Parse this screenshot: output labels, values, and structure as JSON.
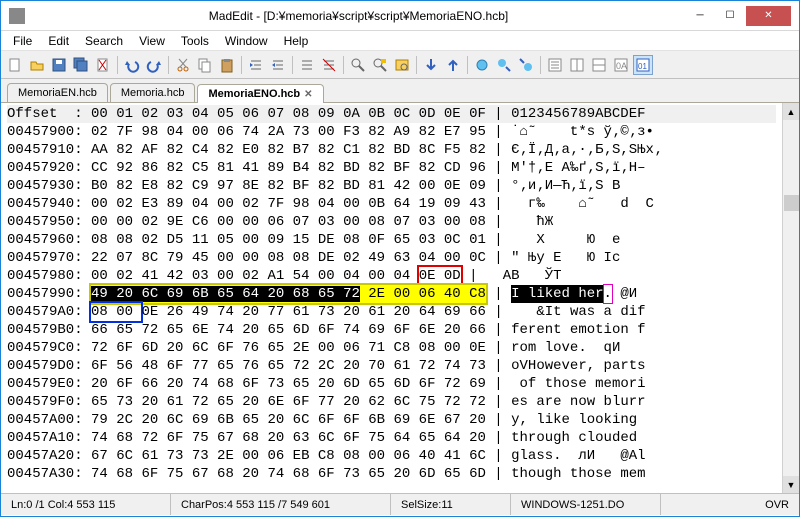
{
  "window": {
    "title": "MadEdit - [D:¥memoria¥script¥script¥MemoriaENO.hcb]"
  },
  "menu": {
    "file": "File",
    "edit": "Edit",
    "search": "Search",
    "view": "View",
    "tools": "Tools",
    "window": "Window",
    "help": "Help"
  },
  "tabs": [
    {
      "label": "MemoriaEN.hcb",
      "active": false
    },
    {
      "label": "Memoria.hcb",
      "active": false
    },
    {
      "label": "MemoriaENO.hcb",
      "active": true
    }
  ],
  "hex": {
    "header_offset": "Offset  ",
    "header_cols": ": 00 01 02 03 04 05 06 07 08 09 0A 0B 0C 0D 0E 0F | 0123456789ABCDEF",
    "rows": [
      {
        "off": "00457900",
        "b": "02 7F 98 04 00 06 74 2A 73 00 F3 82 A9 82 E7 95",
        "a": "˙⌂˜    t*s ў‚©‚з•"
      },
      {
        "off": "00457910",
        "b": "AA 82 AF 82 C4 82 E0 82 B7 82 C1 82 BD 8C F5 82",
        "a": "Є‚Ї‚Д‚а‚·‚Б‚Ѕ,SЊх‚"
      },
      {
        "off": "00457920",
        "b": "CC 92 86 82 C5 81 41 89 B4 82 BD 82 BF 82 CD 96",
        "a": "М'†‚Е A‰ґ‚Ѕ‚ї‚Н–"
      },
      {
        "off": "00457930",
        "b": "B0 82 E8 82 C9 97 8E 82 BF 82 BD 81 42 00 0E 09",
        "a": "°‚и‚И—Ћ‚ї‚Ѕ B   "
      },
      {
        "off": "00457940",
        "b": "00 02 E3 89 04 00 02 7F 98 04 00 0B 64 19 09 43",
        "a": "  г‰    ⌂˜   d  C"
      },
      {
        "off": "00457950",
        "b": "00 00 02 9E C6 00 00 06 07 03 00 08 07 03 00 08",
        "a": "   ћЖ           "
      },
      {
        "off": "00457960",
        "b": "08 08 02 D5 11 05 00 09 15 DE 08 0F 65 03 0C 01",
        "a": "   Х     Ю  e   "
      },
      {
        "off": "00457970",
        "b": "22 07 8C 79 45 00 00 08 08 DE 02 49 63 04 00 0C",
        "a": "\" Њy E   Ю Ic   "
      },
      {
        "off": "00457980",
        "b": "00 02 41 42 03 00 02 A1 54 00 04 00 04 ",
        "a": "  AB   ЎT     ",
        "tail_b": "0E 0D",
        "tail_a": "  ",
        "tail_box": "red"
      },
      {
        "off": "00457990",
        "b_sel": "49 20 6C 69 6B 65 64 20 68 65 72",
        "b_mid": "2E 00 ",
        "b_rest": "06 40 C8",
        "a_sel": "I liked her",
        "a_mag": ".",
        "a_rest": " @И"
      },
      {
        "off": "004579A0",
        "b_pre": "08 00 ",
        "b": "0E 26 49 74 20 77 61 73 20 61 20 64 69 66",
        "a": " &It was a dif",
        "pre_box": "blue"
      },
      {
        "off": "004579B0",
        "b": "66 65 72 65 6E 74 20 65 6D 6F 74 69 6F 6E 20 66",
        "a": "ferent emotion f"
      },
      {
        "off": "004579C0",
        "b": "72 6F 6D 20 6C 6F 76 65 2E 00 06 71 C8 08 00 0E",
        "a": "rom love.  qИ   "
      },
      {
        "off": "004579D0",
        "b": "6F 56 48 6F 77 65 76 65 72 2C 20 70 61 72 74 73",
        "a": "oVHowever, parts"
      },
      {
        "off": "004579E0",
        "b": "20 6F 66 20 74 68 6F 73 65 20 6D 65 6D 6F 72 69",
        "a": " of those memori"
      },
      {
        "off": "004579F0",
        "b": "65 73 20 61 72 65 20 6E 6F 77 20 62 6C 75 72 72",
        "a": "es are now blurr"
      },
      {
        "off": "00457A00",
        "b": "79 2C 20 6C 69 6B 65 20 6C 6F 6F 6B 69 6E 67 20",
        "a": "y, like looking "
      },
      {
        "off": "00457A10",
        "b": "74 68 72 6F 75 67 68 20 63 6C 6F 75 64 65 64 20",
        "a": "through clouded "
      },
      {
        "off": "00457A20",
        "b": "67 6C 61 73 73 2E 00 06 EB C8 08 00 06 40 41 6C",
        "a": "glass.  лИ   @Al"
      },
      {
        "off": "00457A30",
        "b": "74 68 6F 75 67 68 20 74 68 6F 73 65 20 6D 65 6D",
        "a": "though those mem"
      }
    ]
  },
  "status": {
    "pos": "Ln:0 /1 Col:4 553 115",
    "charpos": "CharPos:4 553 115 /7 549 601",
    "selsize": "SelSize:11",
    "encoding": "WINDOWS-1251.DO",
    "mode": "OVR"
  }
}
